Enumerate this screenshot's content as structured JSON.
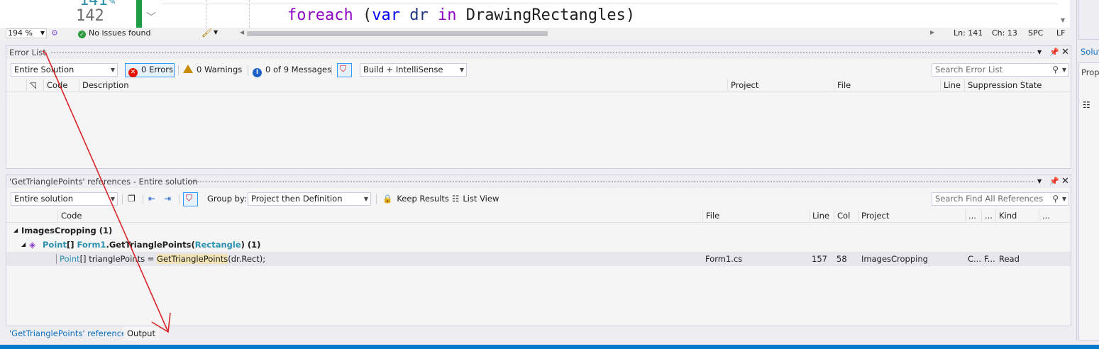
{
  "editor": {
    "line_prev": "141",
    "line_current": "142",
    "code_kw_foreach": "foreach",
    "code_paren_open": " (",
    "code_kw_var": "var",
    "code_var_name": " dr ",
    "code_kw_in": "in",
    "code_rest": " DrawingRectangles)"
  },
  "editor_status": {
    "zoom": "194 %",
    "issues": "No issues found",
    "ln": "Ln: 141",
    "ch": "Ch: 13",
    "spc": "SPC",
    "lf": "LF"
  },
  "error_list": {
    "title": "Error List",
    "scope": "Entire Solution",
    "errors": "0 Errors",
    "warnings": "0 Warnings",
    "messages": "0 of 9 Messages",
    "build": "Build + IntelliSense",
    "search_placeholder": "Search Error List",
    "columns": [
      "Code",
      "Description",
      "Project",
      "File",
      "Line",
      "Suppression State"
    ]
  },
  "references": {
    "title": "'GetTrianglePoints' references - Entire solution",
    "scope": "Entire solution",
    "group_by_label": "Group by:",
    "group_by_value": "Project then Definition",
    "keep_results": "Keep Results",
    "list_view": "List View",
    "search_placeholder": "Search Find All References",
    "columns": [
      "Code",
      "File",
      "Line",
      "Col",
      "Project",
      "...",
      "...",
      "Kind",
      "..."
    ],
    "group_project": "ImagesCropping",
    "group_project_count": "(1)",
    "def_type": "Point",
    "def_brackets": "[] ",
    "def_class": "Form1",
    "def_dot": ".",
    "def_method": "GetTrianglePoints",
    "def_open": "(",
    "def_param": "Rectangle",
    "def_close": ")",
    "def_count": "(1)",
    "row": {
      "code_type": "Point",
      "code_mid": "[] trianglePoints = ",
      "code_method": "GetTrianglePoints",
      "code_end": "(dr.Rect);",
      "file": "Form1.cs",
      "line": "157",
      "col": "58",
      "project": "ImagesCropping",
      "c1": "C...",
      "c2": "F...",
      "kind": "Read"
    }
  },
  "bottom_tabs": [
    "'GetTrianglePoints' references",
    "Output"
  ],
  "right_strip": {
    "solution_tab": "Solut",
    "properties_tab": "Prope"
  },
  "colors": {
    "accent": "#007acc",
    "change_bar": "#1f9d44",
    "annotation_arrow": "#d9252a"
  }
}
